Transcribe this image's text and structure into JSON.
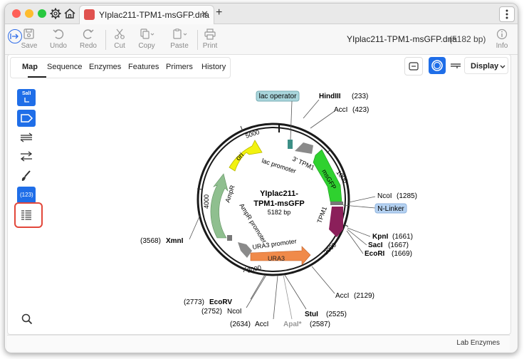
{
  "window": {
    "tab_title": "YIplac211-TPM1-msGFP.dna",
    "tab_close": "✕",
    "new_tab": "+"
  },
  "toolbar": {
    "save": "Save",
    "undo": "Undo",
    "redo": "Redo",
    "cut": "Cut",
    "copy": "Copy",
    "paste": "Paste",
    "print": "Print",
    "info": "Info",
    "file_title": "YIplac211-TPM1-msGFP.dna",
    "length": "(5182 bp)"
  },
  "view_tabs": [
    "Map",
    "Sequence",
    "Enzymes",
    "Features",
    "Primers",
    "History"
  ],
  "display_button": "Display",
  "left_tools": {
    "sall_label": "SalI",
    "count_label": "(123)"
  },
  "map": {
    "name_line1": "YIplac211-",
    "name_line2": "TPM1-msGFP",
    "size": "5182 bp",
    "ticks": [
      "1000",
      "2000",
      "3000",
      "4000",
      "5000"
    ],
    "features": {
      "lac_operator": "lac operator",
      "n_linker": "N-Linker",
      "ori": "ori",
      "msgfp": "msGFP",
      "tpm1": "TPM1",
      "tpm1_3": "3' TPM1",
      "lac_promoter": "lac promoter",
      "ampr": "AmpR",
      "ampr_promoter": "AmpR promoter",
      "ura3_promoter": "URA3 promoter",
      "ura3": "URA3"
    },
    "enzymes": {
      "hindiii_name": "HindIII",
      "hindiii_pos": "(233)",
      "acci1_name": "AccI",
      "acci1_pos": "(423)",
      "ncoi1_name": "NcoI",
      "ncoi1_pos": "(1285)",
      "kpni_name": "KpnI",
      "kpni_pos": "(1661)",
      "saci_name": "SacI",
      "saci_pos": "(1667)",
      "ecori_name": "EcoRI",
      "ecori_pos": "(1669)",
      "acci2_name": "AccI",
      "acci2_pos": "(2129)",
      "stui_name": "StuI",
      "stui_pos": "(2525)",
      "apai_name": "ApaI*",
      "apai_pos": "(2587)",
      "acci3_pos": "(2634)",
      "acci3_name": "AccI",
      "ncoi2_pos": "(2752)",
      "ncoi2_name": "NcoI",
      "ecorv_pos": "(2773)",
      "ecorv_name": "EcoRV",
      "xmni_pos": "(3568)",
      "xmni_name": "XmnI"
    }
  },
  "colors": {
    "accent": "#1f6ee8",
    "ori": "#f2f20f",
    "msgfp": "#2fd12f",
    "tpm1": "#8b1f5a",
    "ampr": "#8fbf8f",
    "ura3": "#f08a4a",
    "highlight": "#e2473a"
  },
  "status": {
    "text": "Lab Enzymes"
  }
}
